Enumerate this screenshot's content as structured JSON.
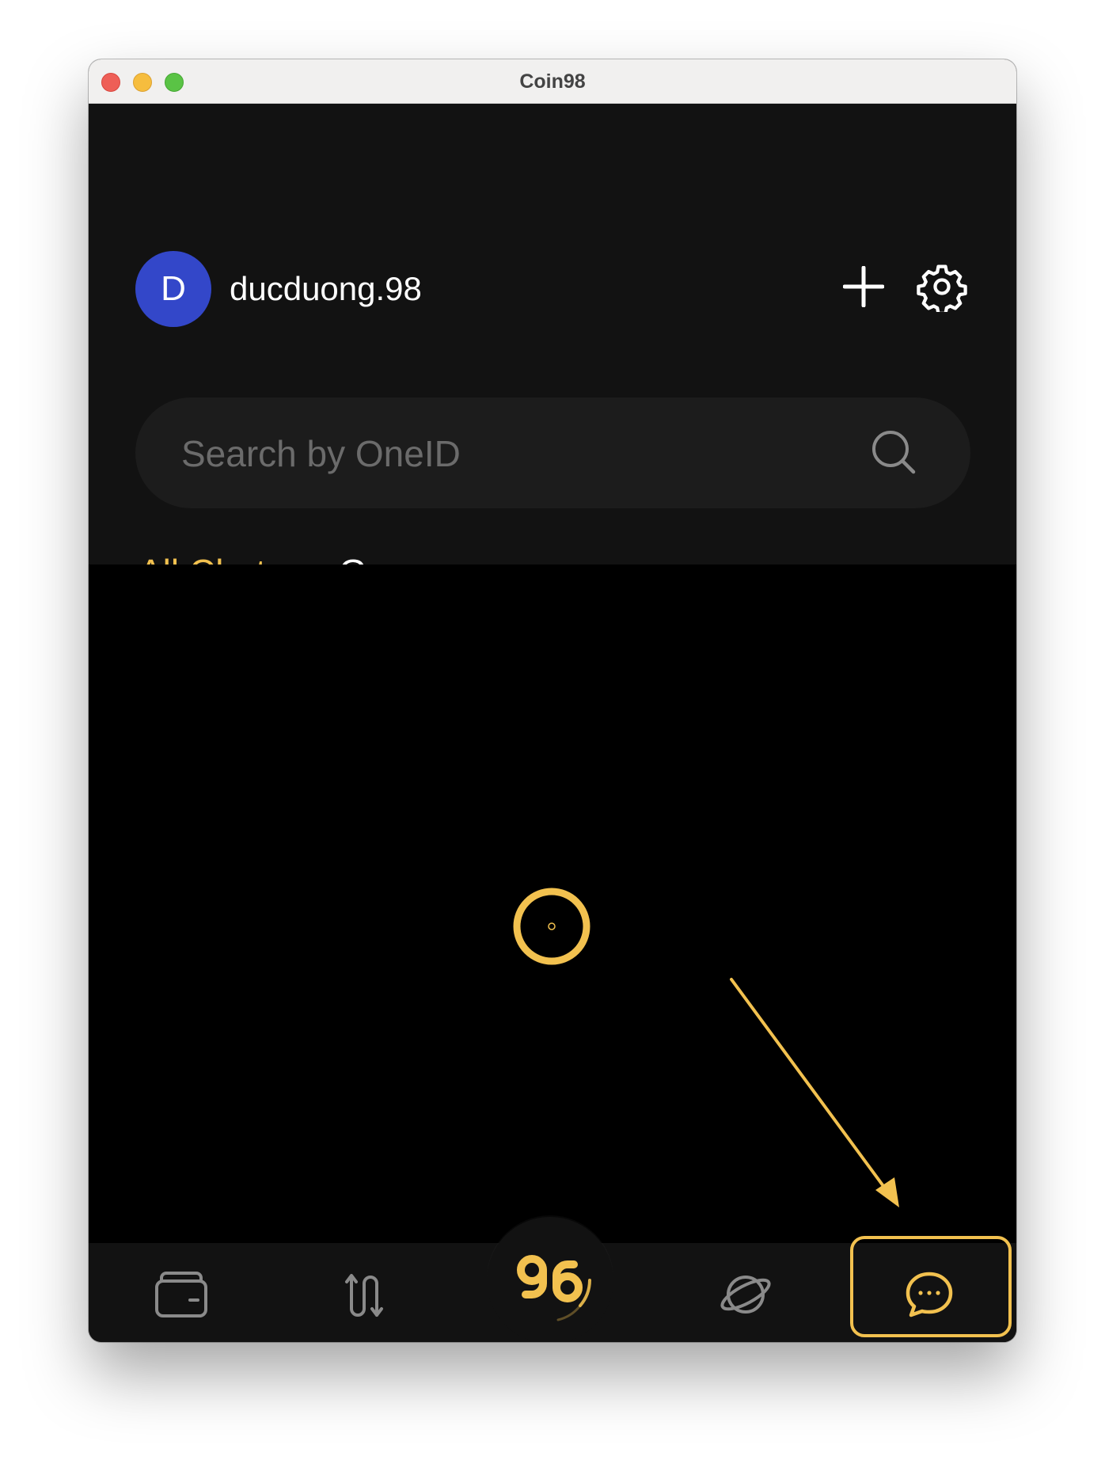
{
  "window": {
    "title": "Coin98"
  },
  "header": {
    "avatar_initial": "D",
    "username": "ducduong.98",
    "add_icon": "plus-icon",
    "settings_icon": "gear-icon"
  },
  "search": {
    "placeholder": "Search by OneID",
    "icon": "search-icon"
  },
  "tabs": [
    {
      "label": "All Chats",
      "active": true
    },
    {
      "label": "Groups",
      "active": false
    }
  ],
  "content": {
    "state": "loading",
    "loading_icon": "spinner-icon"
  },
  "bottom_nav": {
    "items": [
      {
        "icon": "wallet-icon"
      },
      {
        "icon": "swap-icon"
      },
      {
        "icon": "coin98-logo"
      },
      {
        "icon": "planet-icon"
      },
      {
        "icon": "chat-icon",
        "highlighted": true
      }
    ]
  },
  "colors": {
    "accent": "#f2c14f",
    "avatar": "#3347c9",
    "panel": "#121212",
    "background": "#000000"
  }
}
